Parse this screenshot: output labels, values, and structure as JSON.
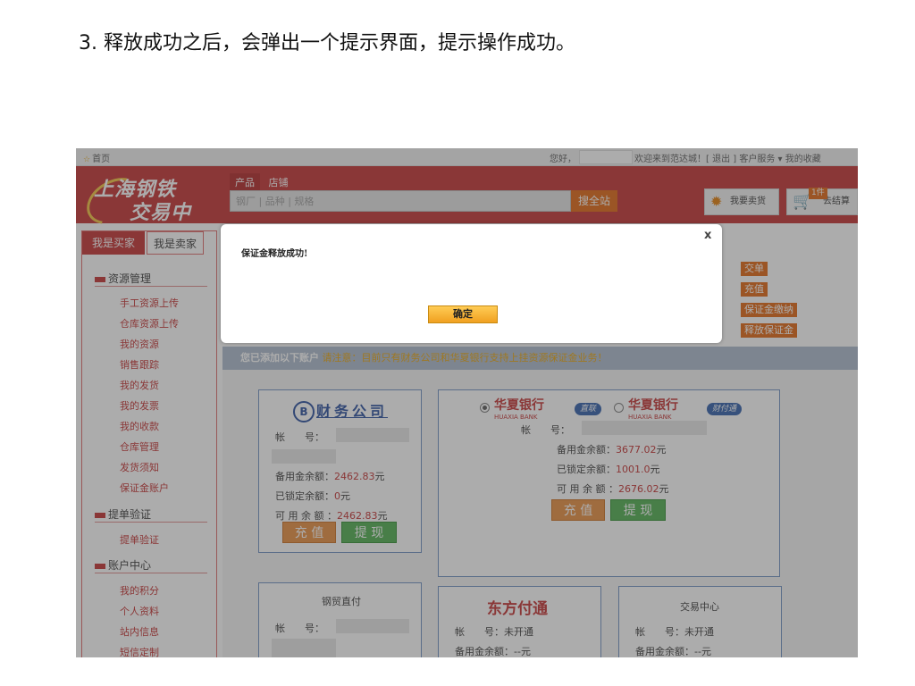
{
  "step_text": "3. 释放成功之后，会弹出一个提示界面，提示操作成功。",
  "topbar": {
    "home": "首页",
    "greeting": "您好，",
    "welcome": "欢迎来到范达城！[ 退出 ]  客户服务 ▾   我的收藏"
  },
  "header": {
    "logo_line1": "上海钢铁",
    "logo_line2": "交易中心",
    "tab_product": "产品",
    "tab_shop": "店铺",
    "search_placeholder": "钢厂 | 品种 | 规格",
    "search_button": "搜全站",
    "sell_button": "我要卖货",
    "cart_count": "1件",
    "cart_button": "去结算"
  },
  "sidebar": {
    "tab_buyer": "我是买家",
    "tab_seller": "我是卖家",
    "sections": [
      {
        "title": "资源管理",
        "items": [
          "手工资源上传",
          "仓库资源上传",
          "我的资源",
          "销售跟踪",
          "我的发货",
          "我的发票",
          "我的收款",
          "仓库管理",
          "发货须知",
          "保证金账户"
        ]
      },
      {
        "title": "提单验证",
        "items": [
          "提单验证"
        ]
      },
      {
        "title": "账户中心",
        "items": [
          "我的积分",
          "个人资料",
          "站内信息",
          "短信定制"
        ]
      }
    ]
  },
  "right_buttons": [
    "交单",
    "充值",
    "保证金缴纳",
    "释放保证金"
  ],
  "notice": {
    "bold": "您已添加以下账户",
    "orange": " 请注意：",
    "rest": "目前只有财务公司和华夏银行支持上挂资源保证金业务！"
  },
  "finance": {
    "title": "财务公司",
    "account_label": "帐　　号：",
    "deposit_label": "备用金余额：",
    "deposit_value": "2462.83",
    "locked_label": "已锁定余额：",
    "locked_value": "0",
    "available_label": "可 用 余 额 ：",
    "available_value": "2462.83",
    "unit": "元",
    "recharge": "充 值",
    "withdraw": "提 现"
  },
  "huaxia": {
    "bank_name": "华夏银行",
    "bank_en": "HUAXIA BANK",
    "pill1": "直联",
    "pill2": "财付通",
    "account_label": "帐　　号：",
    "deposit_label": "备用金余额：",
    "deposit_value": "3677.02",
    "locked_label": "已锁定余额：",
    "locked_value": "1001.0",
    "available_label": "可 用 余 额 ：",
    "available_value": "2676.02",
    "unit": "元",
    "recharge": "充 值",
    "withdraw": "提 现"
  },
  "steel": {
    "title": "钢贸直付",
    "account_label": "帐　　号："
  },
  "dongfang": {
    "title": "东方付通",
    "account_label": "帐　　号：",
    "account_value": "未开通",
    "deposit_label": "备用金余额：",
    "deposit_value": "--元"
  },
  "trade": {
    "title": "交易中心",
    "account_label": "帐　　号：",
    "account_value": "未开通",
    "deposit_label": "备用金余额：",
    "deposit_value": "--元"
  },
  "dialog": {
    "message": "保证金释放成功!",
    "close": "x",
    "ok": "确定"
  }
}
